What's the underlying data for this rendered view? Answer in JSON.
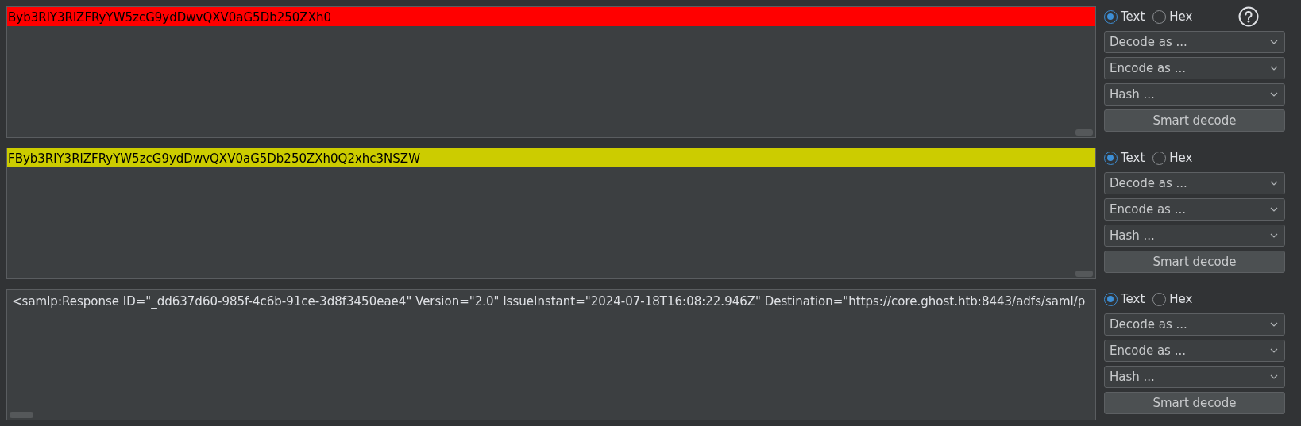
{
  "panels": [
    {
      "content": {
        "text": "Byb3RlY3RlZFRyYW5zcG9ydDwvQXV0aG5Db250ZXh0",
        "color": "#ff0000"
      },
      "formats": [
        {
          "label": "Text",
          "selected": true
        },
        {
          "label": "Hex",
          "selected": false
        }
      ],
      "help": true,
      "dropdowns": [
        "Decode as ...",
        "Encode as ...",
        "Hash ..."
      ],
      "button": "Smart decode"
    },
    {
      "content": {
        "text": "FByb3RlY3RlZFRyYW5zcG9ydDwvQXV0aG5Db250ZXh0Q2xhc3NSZW",
        "color": "#cccc00"
      },
      "formats": [
        {
          "label": "Text",
          "selected": true
        },
        {
          "label": "Hex",
          "selected": false
        }
      ],
      "help": false,
      "dropdowns": [
        "Decode as ...",
        "Encode as ...",
        "Hash ..."
      ],
      "button": "Smart decode"
    },
    {
      "content": {
        "text": "<samlp:Response ID=\"_dd637d60-985f-4c6b-91ce-3d8f3450eae4\" Version=\"2.0\" IssueInstant=\"2024-07-18T16:08:22.946Z\" Destination=\"https://core.ghost.htb:8443/adfs/saml/p"
      },
      "formats": [
        {
          "label": "Text",
          "selected": true
        },
        {
          "label": "Hex",
          "selected": false
        }
      ],
      "help": false,
      "dropdowns": [
        "Decode as ...",
        "Encode as ...",
        "Hash ..."
      ],
      "button": "Smart decode"
    }
  ]
}
